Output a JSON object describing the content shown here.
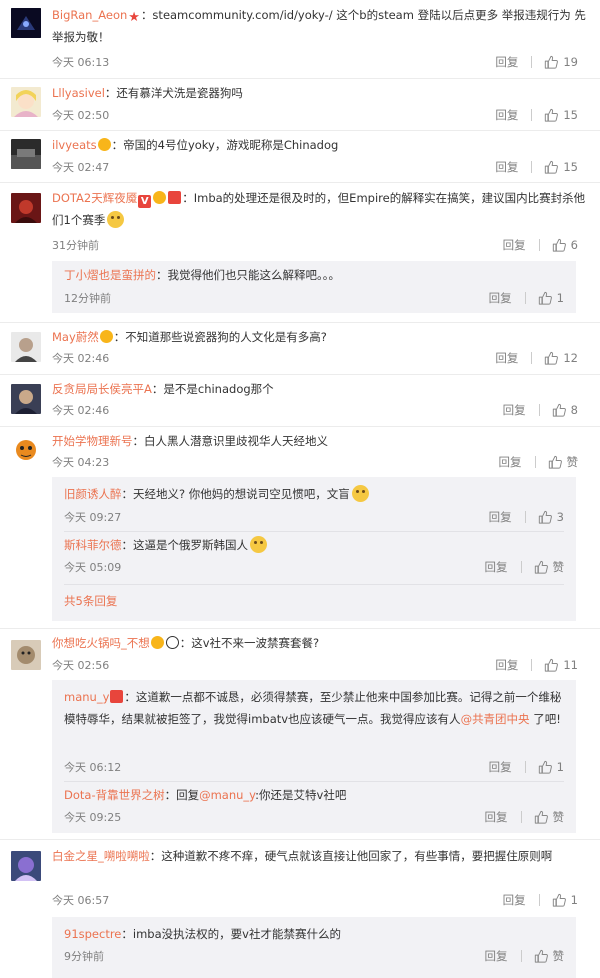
{
  "comments": [
    {
      "user": "BigRan_Aeon",
      "text": "：steamcommunity.com/id/yoky-/ 这个b的steam 登陆以后点更多 举报违规行为 先举报为敬！",
      "time": "今天 06:13",
      "reply": "回复",
      "likes": "19"
    },
    {
      "user": "Lllyasivel",
      "text": "：还有慕洋犬洗是瓷器狗吗",
      "time": "今天 02:50",
      "reply": "回复",
      "likes": "15"
    },
    {
      "user": "ilvyeats",
      "text": "：帝国的4号位yoky，游戏昵称是Chinadog",
      "time": "今天 02:47",
      "reply": "回复",
      "likes": "15"
    },
    {
      "user": "DOTA2天辉夜魇",
      "text": "：Imba的处理还是很及时的，但Empire的解释实在搞笑，建议国内比赛封杀他们1个赛季",
      "time": "31分钟前",
      "reply": "回复",
      "likes": "6"
    },
    {
      "user": "May蔚然",
      "text": "：不知道那些说瓷器狗的人文化是有多高?",
      "time": "今天 02:46",
      "reply": "回复",
      "likes": "12"
    },
    {
      "user": "反贪局局长侯亮平A",
      "text": "：是不是chinadog那个",
      "time": "今天 02:46",
      "reply": "回复",
      "likes": "8"
    },
    {
      "user": "开始学物理新号",
      "text": "：白人黑人潜意识里歧视华人天经地义",
      "time": "今天 04:23",
      "reply": "回复",
      "likes": "赞"
    },
    {
      "user": "你想吃火锅吗_不想",
      "text": "：这v社不来一波禁赛套餐?",
      "time": "今天 02:56",
      "reply": "回复",
      "likes": "11"
    },
    {
      "user": "白金之星_嗍啦嗍啦",
      "text": "：这种道歉不疼不痒，硬气点就该直接让他回家了，有些事情，要把握住原则啊",
      "time": "今天 06:57",
      "reply": "回复",
      "likes": "1"
    }
  ],
  "subs": [
    {
      "user": "丁小熠也是蛮拼的",
      "text": "：我觉得他们也只能这么解释吧。。。",
      "time": "12分钟前",
      "reply": "回复",
      "likes": "1"
    },
    {
      "user": "旧颜诱人醉",
      "text": "：天经地义? 你他妈的想说司空见惯吧，文盲",
      "time": "今天 09:27",
      "reply": "回复",
      "likes": "3"
    },
    {
      "user": "斯科菲尔德",
      "text": "：这逼是个俄罗斯韩国人",
      "time": "今天 05:09",
      "reply": "回复",
      "likes": "赞"
    },
    {
      "user": "manu_y",
      "text": "：这道歉一点都不诚恳，必须得禁赛，至少禁止他来中国参加比赛。记得之前一个维秘模特辱华，结果就被拒签了，我觉得imbatv也应该硬气一点。我觉得应该有人",
      "mention": "@共青团中央",
      "text2": " 了吧!",
      "time": "今天 06:12",
      "reply": "回复",
      "likes": "1"
    },
    {
      "user": "Dota-背靠世界之树",
      "text": "：回复",
      "mention": "@manu_y",
      "text2": ":你还是艾特v社吧",
      "time": "今天 09:25",
      "reply": "回复",
      "likes": "赞"
    },
    {
      "user": "91spectre",
      "text": "：imba没执法权的，要v社才能禁赛什么的",
      "time": "9分钟前",
      "reply": "回复",
      "likes": "赞"
    }
  ],
  "more_replies": "共5条回复",
  "colors": {
    "username": "#eb7350",
    "meta": "#808080",
    "subbox": "#f2f2f5"
  }
}
